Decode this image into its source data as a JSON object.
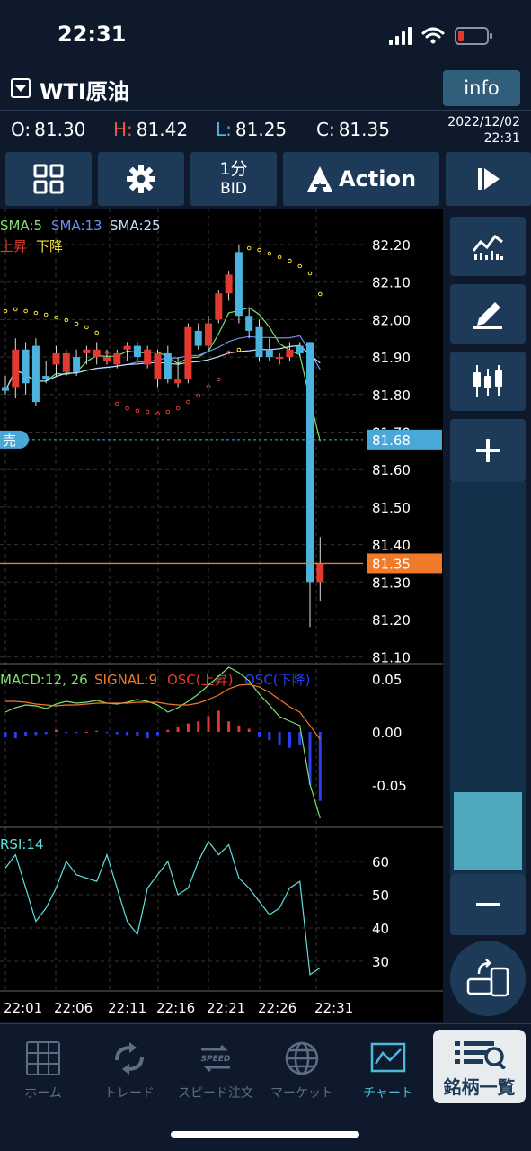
{
  "status": {
    "time": "22:31"
  },
  "header": {
    "symbol": "WTI原油",
    "info_label": "info"
  },
  "ohlc": {
    "open_key": "O:",
    "open": "81.30",
    "high_key": "H:",
    "high": "81.42",
    "low_key": "L:",
    "low": "81.25",
    "close_key": "C:",
    "close": "81.35",
    "date": "2022/12/02",
    "time": "22:31"
  },
  "toolbar": {
    "interval_top": "1分",
    "interval_bottom": "BID",
    "action_label": "Action"
  },
  "chart": {
    "indicators_label_sma5": "SMA:5",
    "indicators_label_sma13": "SMA:13",
    "indicators_label_sma25": "SMA:25",
    "legend_up": "上昇",
    "legend_down": "下降",
    "sell_badge": "売",
    "sell_price": "81.68",
    "current_price": "81.35",
    "price_ticks": [
      "82.20",
      "82.10",
      "82.00",
      "81.90",
      "81.80",
      "81.70",
      "81.60",
      "81.50",
      "81.40",
      "81.30",
      "81.20",
      "81.10"
    ],
    "macd_label": "MACD:12, 26",
    "signal_label": "SIGNAL:9",
    "osc_up_label": "OSC(上昇)",
    "osc_down_label": "OSC(下降)",
    "macd_ticks": [
      "0.05",
      "0.00",
      "-0.05"
    ],
    "rsi_label": "RSI:14",
    "rsi_ticks": [
      "60",
      "50",
      "40",
      "30"
    ],
    "time_ticks": [
      "22:01",
      "22:06",
      "22:11",
      "22:16",
      "22:21",
      "22:26",
      "22:31"
    ]
  },
  "colors": {
    "up": "#e23a2e",
    "down": "#4bb3de",
    "sma5": "#7fe06f",
    "sma13": "#6f8ff0",
    "sma25": "#bfe0ff",
    "sar": "#f5e23a",
    "sell": "#4aa8d8",
    "price_line": "#f07a2a",
    "osc_down": "#2a3ff0",
    "rsi": "#5fe0e0"
  },
  "chart_data": {
    "type": "candlestick",
    "x": [
      "22:00",
      "22:01",
      "22:02",
      "22:03",
      "22:04",
      "22:05",
      "22:06",
      "22:07",
      "22:08",
      "22:09",
      "22:10",
      "22:11",
      "22:12",
      "22:13",
      "22:14",
      "22:15",
      "22:16",
      "22:17",
      "22:18",
      "22:19",
      "22:20",
      "22:21",
      "22:22",
      "22:23",
      "22:24",
      "22:25",
      "22:26",
      "22:27",
      "22:28",
      "22:29",
      "22:30",
      "22:31"
    ],
    "ohlc": [
      [
        81.82,
        81.85,
        81.8,
        81.81
      ],
      [
        81.82,
        81.95,
        81.79,
        81.92
      ],
      [
        81.92,
        81.94,
        81.8,
        81.83
      ],
      [
        81.93,
        81.95,
        81.77,
        81.78
      ],
      [
        81.85,
        81.89,
        81.83,
        81.84
      ],
      [
        81.88,
        81.93,
        81.85,
        81.91
      ],
      [
        81.86,
        81.92,
        81.85,
        81.91
      ],
      [
        81.9,
        81.92,
        81.85,
        81.86
      ],
      [
        81.91,
        81.93,
        81.88,
        81.92
      ],
      [
        81.9,
        81.94,
        81.88,
        81.92
      ],
      [
        81.89,
        81.92,
        81.88,
        81.9
      ],
      [
        81.88,
        81.92,
        81.87,
        81.91
      ],
      [
        81.92,
        81.94,
        81.89,
        81.93
      ],
      [
        81.93,
        81.94,
        81.89,
        81.9
      ],
      [
        81.88,
        81.93,
        81.87,
        81.92
      ],
      [
        81.84,
        81.92,
        81.82,
        81.91
      ],
      [
        81.91,
        81.93,
        81.83,
        81.84
      ],
      [
        81.83,
        81.9,
        81.82,
        81.84
      ],
      [
        81.84,
        81.99,
        81.83,
        81.98
      ],
      [
        81.97,
        81.99,
        81.92,
        81.93
      ],
      [
        81.93,
        82.01,
        81.92,
        81.99
      ],
      [
        82.0,
        82.08,
        81.99,
        82.07
      ],
      [
        82.07,
        82.13,
        82.05,
        82.12
      ],
      [
        82.18,
        82.2,
        81.99,
        82.01
      ],
      [
        82.01,
        82.03,
        81.95,
        81.97
      ],
      [
        81.98,
        82.0,
        81.89,
        81.9
      ],
      [
        81.92,
        81.95,
        81.89,
        81.9
      ],
      [
        81.9,
        81.91,
        81.88,
        81.9
      ],
      [
        81.9,
        81.94,
        81.89,
        81.92
      ],
      [
        81.93,
        81.94,
        81.9,
        81.91
      ],
      [
        81.94,
        81.94,
        81.18,
        81.3
      ],
      [
        81.3,
        81.42,
        81.25,
        81.35
      ]
    ],
    "rsi": [
      58,
      62,
      52,
      42,
      46,
      52,
      60,
      56,
      55,
      54,
      62,
      52,
      42,
      38,
      52,
      56,
      60,
      50,
      52,
      60,
      66,
      62,
      65,
      55,
      52,
      48,
      44,
      46,
      52,
      54,
      26,
      28
    ],
    "macd_hist": [
      -0.005,
      -0.006,
      -0.004,
      -0.003,
      -0.002,
      0.002,
      -0.001,
      -0.001,
      0.0,
      0.001,
      -0.001,
      -0.002,
      -0.003,
      -0.004,
      -0.006,
      -0.003,
      0.002,
      0.005,
      0.008,
      0.01,
      0.015,
      0.02,
      0.01,
      0.006,
      0.003,
      -0.005,
      -0.008,
      -0.012,
      -0.015,
      -0.012,
      -0.05,
      -0.065
    ],
    "ylim": [
      81.08,
      82.24
    ]
  }
}
